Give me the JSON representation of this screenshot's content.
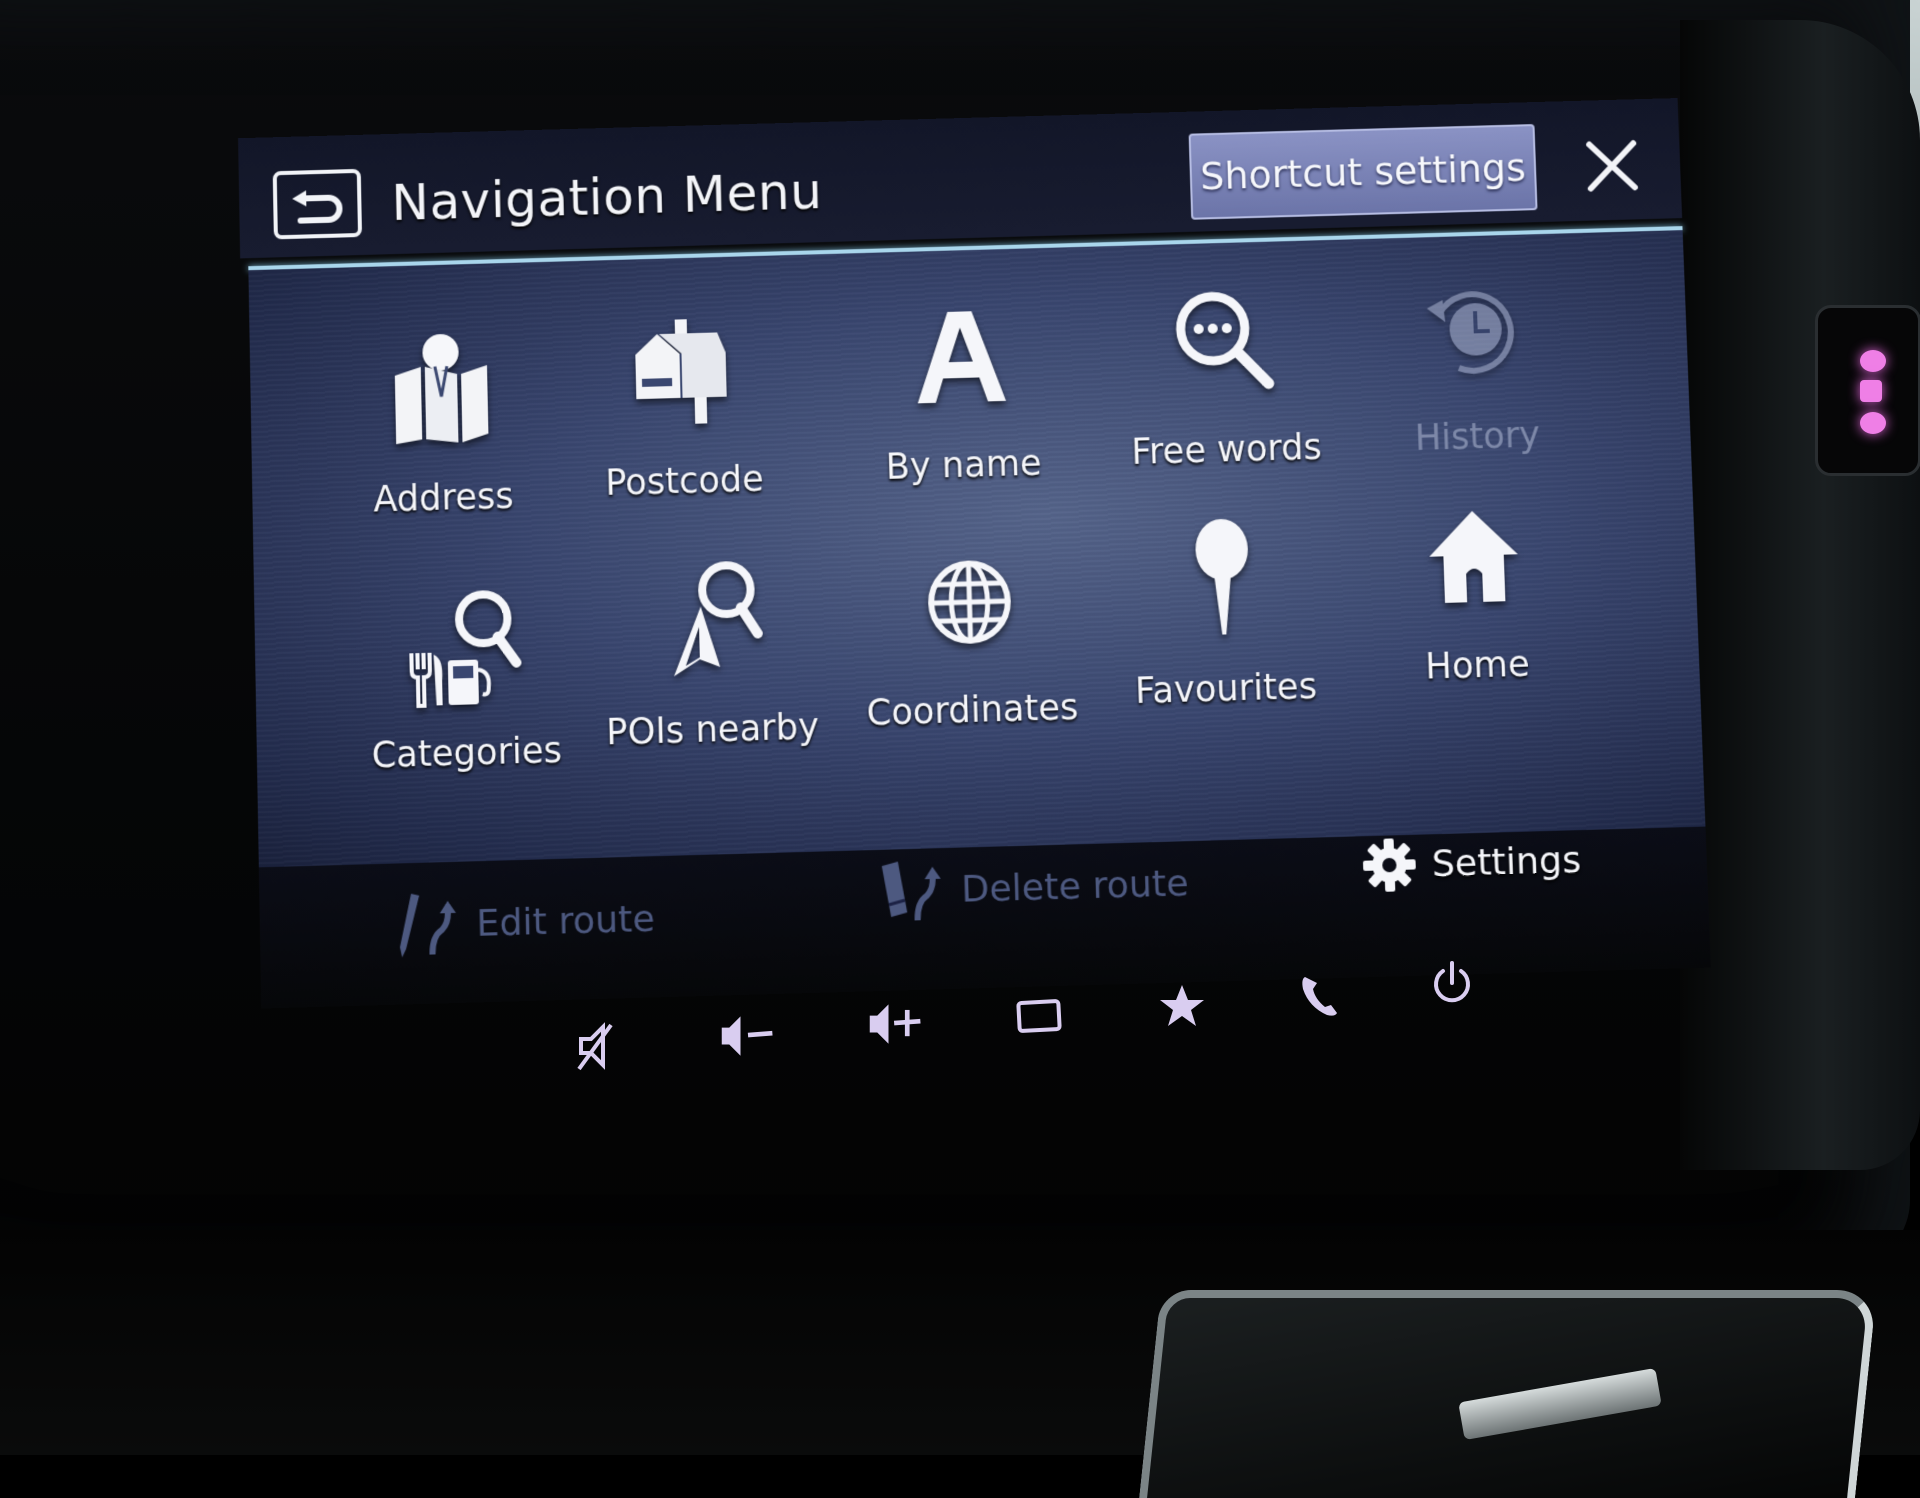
{
  "header": {
    "title": "Navigation Menu",
    "back_icon": "back-arrow-icon",
    "shortcut_settings_label": "Shortcut settings",
    "close_icon": "close-icon"
  },
  "menu": {
    "items": [
      {
        "label": "Address",
        "icon": "map-pin-icon",
        "enabled": true
      },
      {
        "label": "Postcode",
        "icon": "mailbox-icon",
        "enabled": true
      },
      {
        "label": "By name",
        "icon": "letter-a-icon",
        "enabled": true
      },
      {
        "label": "Free words",
        "icon": "search-dots-icon",
        "enabled": true
      },
      {
        "label": "History",
        "icon": "history-icon",
        "enabled": false
      },
      {
        "label": "Categories",
        "icon": "categories-icon",
        "enabled": true
      },
      {
        "label": "POIs nearby",
        "icon": "poi-nearby-icon",
        "enabled": true
      },
      {
        "label": "Coordinates",
        "icon": "globe-icon",
        "enabled": true
      },
      {
        "label": "Favourites",
        "icon": "pushpin-icon",
        "enabled": true
      },
      {
        "label": "Home",
        "icon": "home-icon",
        "enabled": true
      }
    ]
  },
  "bottom_bar": {
    "edit_route_label": "Edit route",
    "edit_route_enabled": false,
    "delete_route_label": "Delete route",
    "delete_route_enabled": false,
    "settings_label": "Settings"
  },
  "hardware_buttons": [
    {
      "name": "mute",
      "icon": "mute-icon"
    },
    {
      "name": "volume-down",
      "icon": "volume-down-icon"
    },
    {
      "name": "volume-up",
      "icon": "volume-up-icon"
    },
    {
      "name": "display",
      "icon": "display-icon"
    },
    {
      "name": "favorite",
      "icon": "star-icon"
    },
    {
      "name": "phone",
      "icon": "phone-icon"
    },
    {
      "name": "power",
      "icon": "power-icon"
    }
  ],
  "colors": {
    "accent_line": "#a9d6ec",
    "shortcut_button": "#7a82b8",
    "disabled_text": "#7d88a8",
    "hardware_icon": "#d9cdf0",
    "side_led": "#ef7fe6"
  }
}
